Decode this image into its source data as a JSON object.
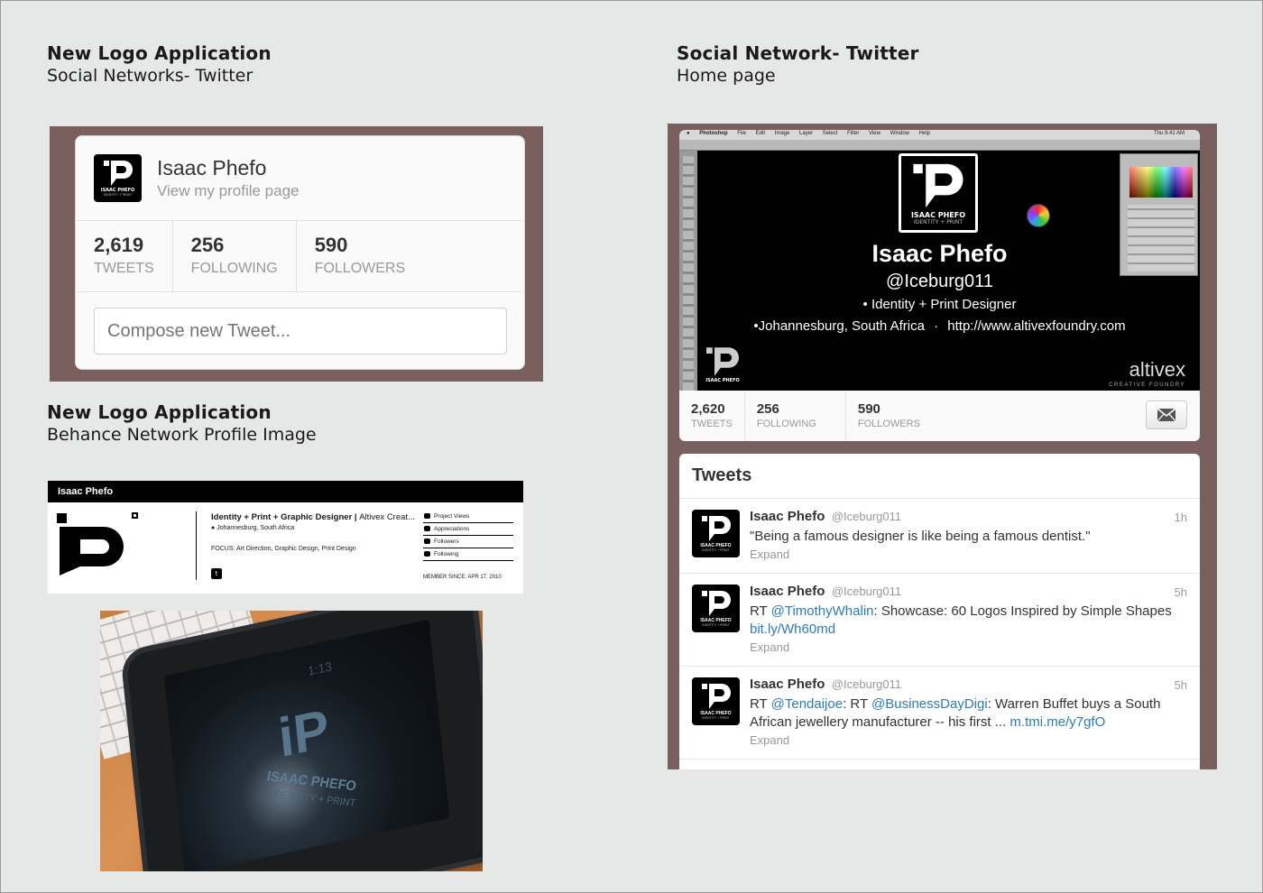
{
  "left_top": {
    "title": "New Logo Application",
    "subtitle": "Social Networks- Twitter"
  },
  "left_mid": {
    "title": "New Logo Application",
    "subtitle": "Behance Network Profile Image"
  },
  "right_top": {
    "title": "Social Network- Twitter",
    "subtitle": "Home page"
  },
  "logo": {
    "text": "ISAAC PHEFO",
    "sub": "IDENTITY + PRINT"
  },
  "profile_card": {
    "name": "Isaac Phefo",
    "link": "View my profile page",
    "stats": [
      {
        "num": "2,619",
        "label": "TWEETS"
      },
      {
        "num": "256",
        "label": "FOLLOWING"
      },
      {
        "num": "590",
        "label": "FOLLOWERS"
      }
    ],
    "compose_placeholder": "Compose new Tweet..."
  },
  "behance": {
    "name": "Isaac Phefo",
    "role": "Identity + Print + Graphic Designer",
    "company": "Altivex Creat...",
    "location": "Johannesburg, South Africa",
    "focus": "FOCUS: Art Direction, Graphic Design, Print Design",
    "twitter_icon": "twitter-icon",
    "links": [
      "Project Views",
      "Appreciations",
      "Followers",
      "Following"
    ],
    "member_since": "MEMBER SINCE: APR 17, 2010"
  },
  "photo": {
    "time": "1:13",
    "logo_mark": "iP",
    "name": "ISAAC PHEFO",
    "sub": "IDENTITY + PRINT"
  },
  "twitter_home": {
    "menubar": {
      "items": [
        "Photoshop",
        "File",
        "Edit",
        "Image",
        "Layer",
        "Select",
        "Filter",
        "View",
        "Window",
        "Help"
      ],
      "clock": "Thu 9:41 AM"
    },
    "name": "Isaac Phefo",
    "handle": "@Iceburg011",
    "bio": "• Identity + Print Designer",
    "location": "•Johannesburg, South Africa",
    "separator": "·",
    "url": "http://www.altivexfoundry.com",
    "brand": "altivex",
    "brand_sub": "CREATIVE FOUNDRY",
    "stats": [
      {
        "num": "2,620",
        "label": "TWEETS"
      },
      {
        "num": "256",
        "label": "FOLLOWING"
      },
      {
        "num": "590",
        "label": "FOLLOWERS"
      }
    ],
    "mail_icon": "envelope-icon",
    "tweets_heading": "Tweets",
    "tweets": [
      {
        "name": "Isaac Phefo",
        "screen_name": "@Iceburg011",
        "time": "1h",
        "text": "\"Being a famous designer is like being a famous dentist.\"",
        "expand": "Expand"
      },
      {
        "name": "Isaac Phefo",
        "screen_name": "@Iceburg011",
        "time": "5h",
        "rt": "RT ",
        "mention": "@TimothyWhalin",
        "text": ": Showcase: 60 Logos Inspired by Simple Shapes ",
        "link": "bit.ly/Wh60md",
        "expand": "Expand"
      },
      {
        "name": "Isaac Phefo",
        "screen_name": "@Iceburg011",
        "time": "5h",
        "rt": "RT ",
        "mention": "@Tendaijoe",
        "mid": ": RT ",
        "mention2": "@BusinessDayDigi",
        "text": ": Warren Buffet buys a South African jewellery manufacturer -- his first ... ",
        "link": "m.tmi.me/y7gfO",
        "expand": "Expand"
      }
    ]
  }
}
